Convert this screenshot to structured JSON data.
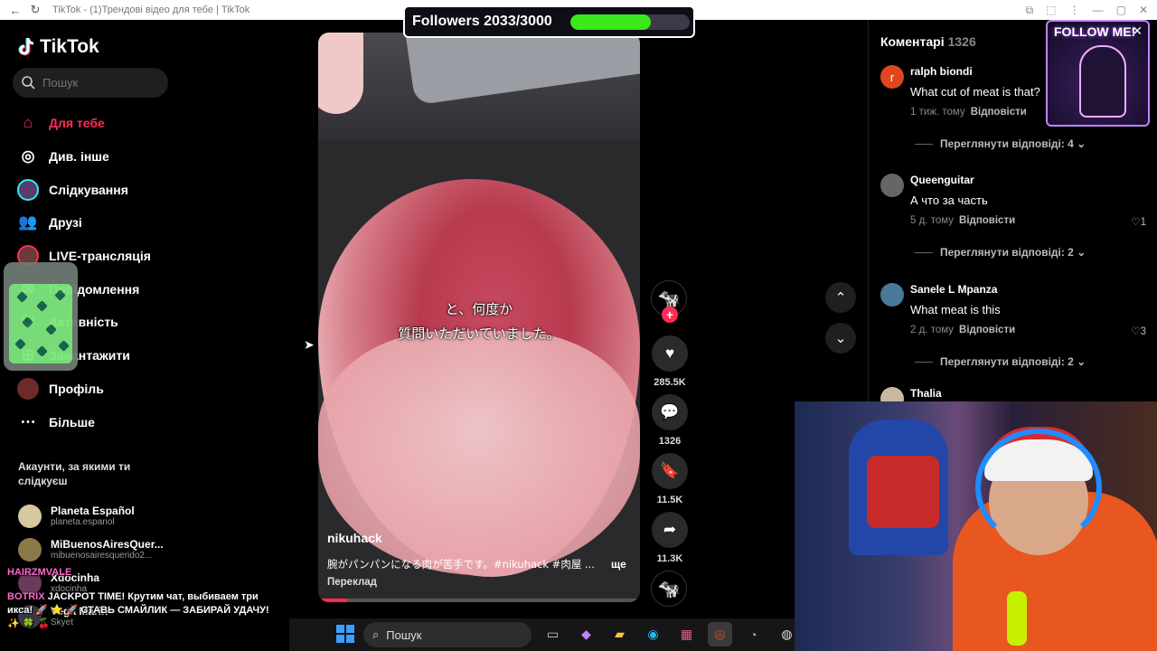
{
  "browser": {
    "tab_title": "TikTok - (1)Трендові відео для тебе | TikTok",
    "back_icon": "back-arrow-icon",
    "reload_icon": "reload-icon"
  },
  "followers_widget": {
    "label": "Followers 2033/3000",
    "current": 2033,
    "goal": 3000,
    "bar_color": "#3be81b"
  },
  "sidebar": {
    "logo": "TikTok",
    "search_placeholder": "Пошук",
    "items": [
      {
        "label": "Для тебе",
        "icon": "home-icon",
        "active": true
      },
      {
        "label": "Див. інше",
        "icon": "compass-icon",
        "active": false
      },
      {
        "label": "Слідкування",
        "icon": "following-avatar-icon",
        "active": false
      },
      {
        "label": "Друзі",
        "icon": "friends-icon",
        "active": false
      },
      {
        "label": "LIVE-трансляція",
        "icon": "live-avatar-icon",
        "active": false
      },
      {
        "label": "Повідомлення",
        "icon": "message-icon",
        "active": false
      },
      {
        "label": "Активність",
        "icon": "activity-icon",
        "active": false
      },
      {
        "label": "Завантажити",
        "icon": "upload-icon",
        "active": false
      },
      {
        "label": "Профіль",
        "icon": "profile-avatar-icon",
        "active": false
      },
      {
        "label": "Більше",
        "icon": "more-icon",
        "active": false
      }
    ],
    "following_header": "Акаунти, за якими ти слідкуєш",
    "accounts": [
      {
        "name": "Planeta Español",
        "handle": "planeta.espanol"
      },
      {
        "name": "MiBuenosAiresQuer...",
        "handle": "mibuenosairesquerido2..."
      },
      {
        "name": "Xdocinha",
        "handle": "xdocinha_"
      },
      {
        "name": "Vega Marin",
        "handle": "Skyet"
      }
    ]
  },
  "chat_overlay": {
    "line1_user": "HAIRZMVALE",
    "line2_user": "BOTRIX",
    "line2_text": "JACKPOT TIME! Крутим чат, выбиваем три икса! 🚀 ⭐ 🚀 СТАВЬ СМАЙЛИК — ЗАБИРАЙ УДАЧУ! ✨ 🍀 🍒"
  },
  "video": {
    "subtitle_line1": "と、何度か",
    "subtitle_line2": "質問いただいていました。",
    "author": "nikuhack",
    "description": "腕がパンパンになる肉が苦手です。#nikuhack #肉屋 ...",
    "more_label": "ще",
    "translate_label": "Переклад",
    "progress": 0.09
  },
  "actions": {
    "likes": "285.5K",
    "comments": "1326",
    "saves": "11.5K",
    "shares": "11.3K"
  },
  "comments_panel": {
    "title": "Коментарі",
    "count": "1326",
    "items": [
      {
        "name": "ralph biondi",
        "text": "What cut of meat is that?",
        "time": "1 тиж. тому",
        "reply": "Відповісти",
        "likes": "",
        "views": "Переглянути відповіді: 4",
        "avatar_color": "#e0461f",
        "avatar_letter": "r"
      },
      {
        "name": "Queenguitar",
        "text": "А что за часть",
        "time": "5 д. тому",
        "reply": "Відповісти",
        "likes": "1",
        "views": "Переглянути відповіді: 2",
        "avatar_color": "#666666",
        "avatar_letter": ""
      },
      {
        "name": "Sanele L Mpanza",
        "text": "What meat is this",
        "time": "2 д. тому",
        "reply": "Відповісти",
        "likes": "3",
        "views": "Переглянути відповіді: 2",
        "avatar_color": "#4a7a9a",
        "avatar_letter": ""
      },
      {
        "name": "Thalia",
        "text": "",
        "time": "",
        "reply": "",
        "likes": "",
        "views": "",
        "avatar_color": "#c9b8a0",
        "avatar_letter": ""
      }
    ]
  },
  "follow_me": {
    "label": "FOLLOW ME!",
    "close": "✕"
  },
  "taskbar": {
    "search_label": "Пошук"
  }
}
